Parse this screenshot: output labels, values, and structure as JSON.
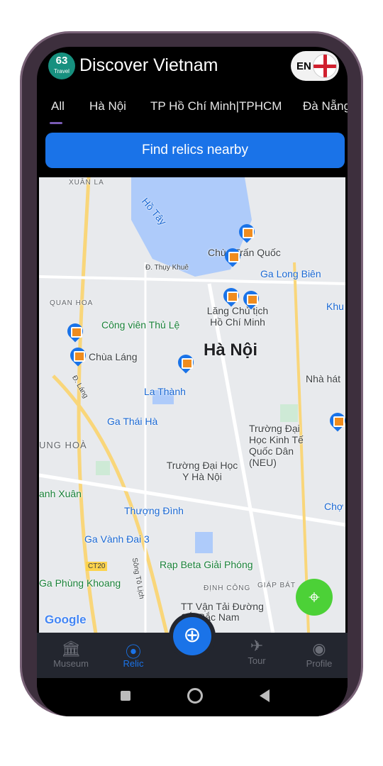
{
  "header": {
    "logo_text": "63",
    "logo_sub": "Travel",
    "title": "Discover Vietnam",
    "lang": "EN"
  },
  "tabs": [
    {
      "label": "All",
      "active": true
    },
    {
      "label": "Hà Nội"
    },
    {
      "label": "TP Hồ Chí Minh|TPHCM"
    },
    {
      "label": "Đà Nẵng"
    }
  ],
  "find_button": "Find relics nearby",
  "map": {
    "labels": [
      "XUÂN LA",
      "Hồ Tây",
      "Chùa Trấn Quốc",
      "Đ. Thụy Khuê",
      "Ga Long Biên",
      "QUAN HOA",
      "Lăng Chủ tịch Hồ Chí Minh",
      "Khu",
      "Công viên Thủ Lệ",
      "Chùa Láng",
      "Hà Nội",
      "Nhà hát",
      "La Thành",
      "Ga Thái Hà",
      "Đ. Láng",
      "UNG HOÀ",
      "Trường Đại Học Kinh Tế Quốc Dân (NEU)",
      "Trường Đại Học Y Hà Nội",
      "anh Xuân",
      "Thượng Đình",
      "Chợ",
      "Ga Vành Đai 3",
      "CT20",
      "Rạp Beta Giải Phóng",
      "Ga Phùng Khoang",
      "ĐỊNH CÔNG",
      "GIÁP BÁT",
      "TT Vận Tải Đường Sắt Bắc Nam",
      "Sông Tô Lịch",
      "Google"
    ]
  },
  "nav": [
    {
      "label": "Museum",
      "icon": "museum-icon"
    },
    {
      "label": "Relic",
      "icon": "relic-pin-icon",
      "active": true
    },
    {
      "label": "Tour",
      "icon": "airplane-icon"
    },
    {
      "label": "Profile",
      "icon": "profile-icon"
    }
  ],
  "colors": {
    "accent": "#1a73e8",
    "locate": "#4cd137",
    "nav_bg": "#23262f"
  }
}
